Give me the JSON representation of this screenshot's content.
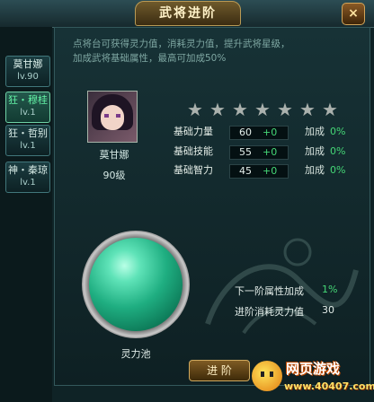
{
  "window": {
    "title": "武将进阶",
    "close_glyph": "×"
  },
  "hero_list": [
    {
      "name": "莫甘娜",
      "level": "lv.90",
      "active": false,
      "name_color": "#d8ece7"
    },
    {
      "name": "狂・穆桂",
      "level": "lv.1",
      "active": true,
      "name_color": "#63f3a6"
    },
    {
      "name": "狂・哲别",
      "level": "lv.1",
      "active": false,
      "name_color": "#d8ece7"
    },
    {
      "name": "神・秦琼",
      "level": "lv.1",
      "active": false,
      "name_color": "#d8ece7"
    }
  ],
  "description": {
    "line1": "点将台可获得灵力值，消耗灵力值，提升武将星级，",
    "line2": "加成武将基础属性，最高可加成50%"
  },
  "hero": {
    "name": "莫甘娜",
    "level": "90级",
    "stars_total": 7,
    "stars_filled": 0
  },
  "star_glyph": "★",
  "stats": [
    {
      "label": "基础力量",
      "value": "60",
      "bonus": "+0",
      "add_label": "加成",
      "percent": "0%"
    },
    {
      "label": "基础技能",
      "value": "55",
      "bonus": "+0",
      "add_label": "加成",
      "percent": "0%"
    },
    {
      "label": "基础智力",
      "value": "45",
      "bonus": "+0",
      "add_label": "加成",
      "percent": "0%"
    }
  ],
  "pool": {
    "label": "灵力池"
  },
  "next_tier": {
    "bonus_label": "下一阶属性加成",
    "bonus_value": "1%",
    "cost_label": "进阶消耗灵力值",
    "cost_value": "30"
  },
  "advance_button": "进 阶",
  "watermark": {
    "text": "网页游戏",
    "url": "www.40407.com"
  },
  "colors": {
    "accent_green": "#45d776",
    "panel": "#173236",
    "gold": "#cfa95e"
  }
}
